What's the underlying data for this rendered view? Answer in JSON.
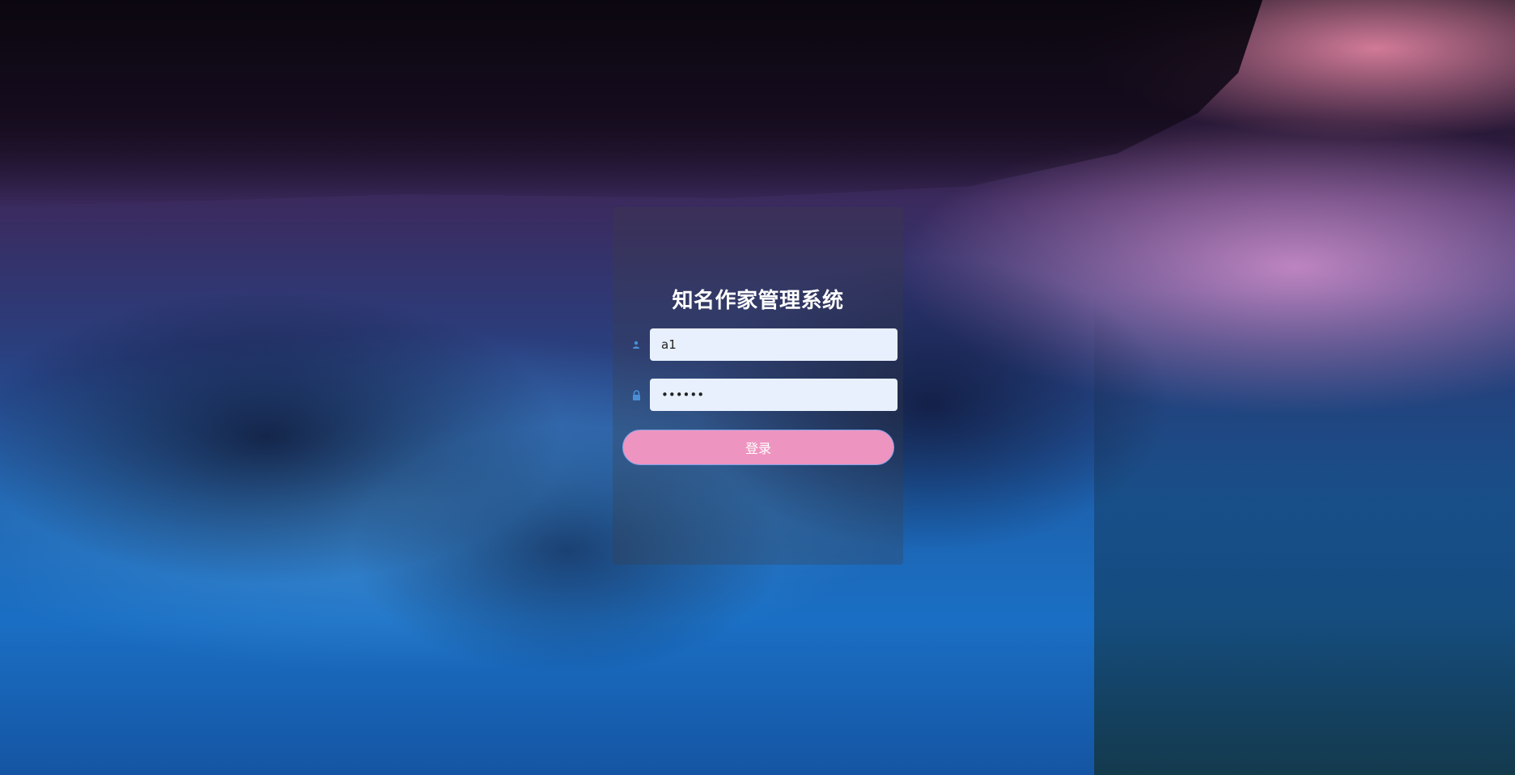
{
  "app": {
    "title": "知名作家管理系统"
  },
  "login_form": {
    "username": {
      "value": "a1",
      "icon": "user-icon"
    },
    "password": {
      "value": "••••••",
      "icon": "lock-icon"
    },
    "submit_label": "登录"
  },
  "colors": {
    "button_bg": "#ee94c0",
    "button_border": "#7da2e6",
    "input_bg": "#e8f0fe",
    "icon": "#4a8fd6"
  }
}
